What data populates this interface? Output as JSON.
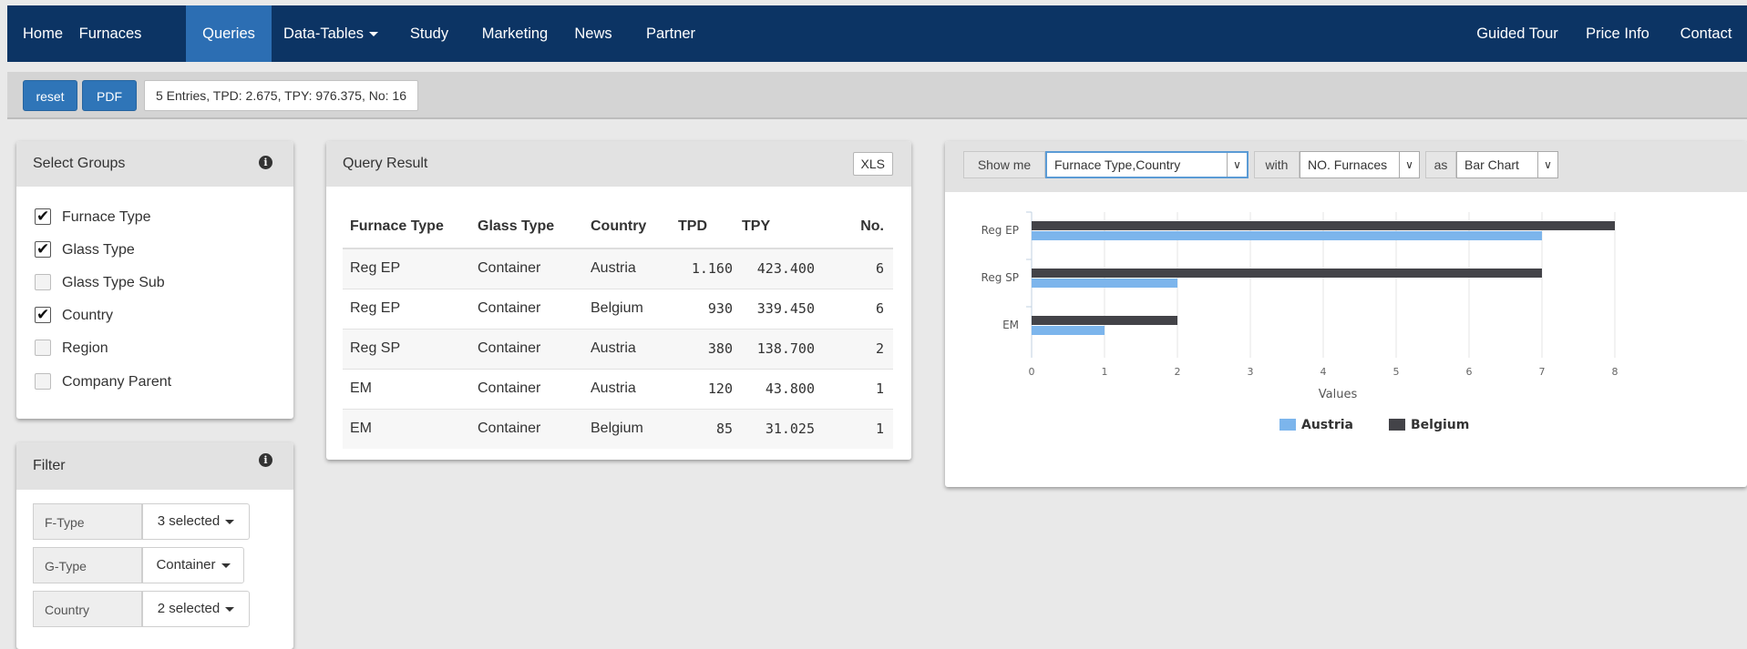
{
  "nav": {
    "left": [
      "Home",
      "Furnaces",
      "Queries",
      "Data-Tables",
      "Study",
      "Marketing",
      "News",
      "Partner"
    ],
    "active": "Queries",
    "right": [
      "Guided Tour",
      "Price Info",
      "Contact"
    ]
  },
  "toolbar": {
    "reset_label": "reset",
    "pdf_label": "PDF",
    "summary": "5 Entries, TPD: 2.675, TPY: 976.375, No: 16"
  },
  "groups": {
    "title": "Select Groups",
    "items": [
      {
        "label": "Furnace Type",
        "checked": true
      },
      {
        "label": "Glass Type",
        "checked": true
      },
      {
        "label": "Glass Type Sub",
        "checked": false
      },
      {
        "label": "Country",
        "checked": true
      },
      {
        "label": "Region",
        "checked": false
      },
      {
        "label": "Company Parent",
        "checked": false
      }
    ]
  },
  "filter": {
    "title": "Filter",
    "rows": [
      {
        "label": "F-Type",
        "value": "3 selected"
      },
      {
        "label": "G-Type",
        "value": "Container"
      },
      {
        "label": "Country",
        "value": "2 selected"
      }
    ]
  },
  "query": {
    "title": "Query Result",
    "xls_label": "XLS",
    "columns": [
      "Furnace Type",
      "Glass Type",
      "Country",
      "TPD",
      "TPY",
      "No."
    ],
    "rows": [
      [
        "Reg EP",
        "Container",
        "Austria",
        "1.160",
        "423.400",
        "6"
      ],
      [
        "Reg EP",
        "Container",
        "Belgium",
        "930",
        "339.450",
        "6"
      ],
      [
        "Reg SP",
        "Container",
        "Austria",
        "380",
        "138.700",
        "2"
      ],
      [
        "EM",
        "Container",
        "Austria",
        "120",
        "43.800",
        "1"
      ],
      [
        "EM",
        "Container",
        "Belgium",
        "85",
        "31.025",
        "1"
      ]
    ]
  },
  "controls": {
    "show_me_label": "Show me",
    "show_me_value": "Furnace Type,Country",
    "with_label": "with",
    "with_value": "NO. Furnaces",
    "as_label": "as",
    "as_value": "Bar Chart",
    "arrow_icon": "chevron-down-icon"
  },
  "chart_data": {
    "type": "bar",
    "orientation": "horizontal",
    "categories": [
      "Reg EP",
      "Reg SP",
      "EM"
    ],
    "series": [
      {
        "name": "Austria",
        "color": "#7cb5ec",
        "values": [
          7,
          2,
          1
        ]
      },
      {
        "name": "Belgium",
        "color": "#434348",
        "values": [
          8,
          7,
          2
        ]
      }
    ],
    "xlabel": "Values",
    "xlim": [
      0,
      8
    ],
    "ticks": [
      0,
      1,
      2,
      3,
      4,
      5,
      6,
      7,
      8
    ],
    "grid": true,
    "legend": "bottom-center"
  }
}
